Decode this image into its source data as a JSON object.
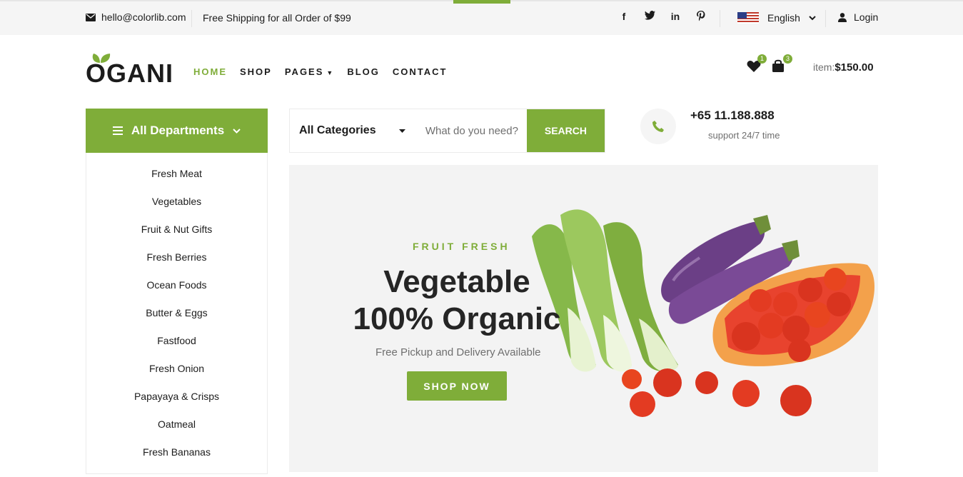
{
  "topbar": {
    "email": "hello@colorlib.com",
    "shipping": "Free Shipping for all Order of $99",
    "socials": [
      "facebook-icon",
      "twitter-icon",
      "linkedin-icon",
      "pinterest-icon"
    ],
    "language": "English",
    "login": "Login"
  },
  "header": {
    "logo": "OGANI",
    "nav": [
      {
        "label": "HOME",
        "active": true
      },
      {
        "label": "SHOP"
      },
      {
        "label": "PAGES"
      },
      {
        "label": "BLOG"
      },
      {
        "label": "CONTACT"
      }
    ],
    "wishlist_count": "1",
    "cart_count": "3",
    "item_label": "item:",
    "item_total": "$150.00"
  },
  "departments": {
    "title": "All Departments",
    "items": [
      "Fresh Meat",
      "Vegetables",
      "Fruit & Nut Gifts",
      "Fresh Berries",
      "Ocean Foods",
      "Butter & Eggs",
      "Fastfood",
      "Fresh Onion",
      "Papayaya & Crisps",
      "Oatmeal",
      "Fresh Bananas"
    ]
  },
  "search": {
    "category": "All Categories",
    "placeholder": "What do you need?",
    "button": "SEARCH"
  },
  "contact": {
    "phone": "+65 11.188.888",
    "support": "support 24/7 time"
  },
  "hero": {
    "kicker": "FRUIT FRESH",
    "title_line1": "Vegetable",
    "title_line2": "100% Organic",
    "subtitle": "Free Pickup and Delivery Available",
    "button": "SHOP NOW"
  },
  "colors": {
    "accent": "#7fad39",
    "text": "#1c1c1c",
    "muted": "#6f6f6f"
  }
}
